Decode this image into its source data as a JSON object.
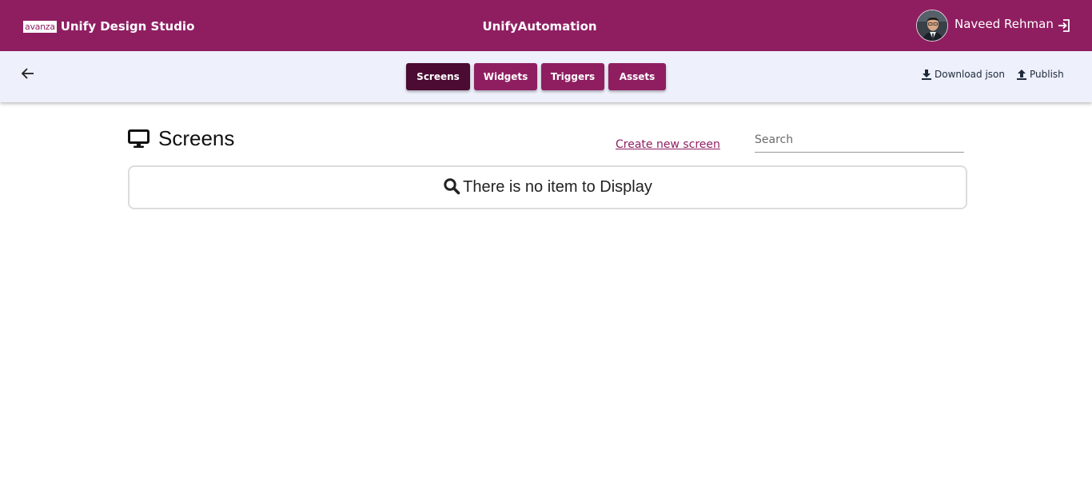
{
  "header": {
    "logo_text": "avanza",
    "app_name": "Unify Design Studio",
    "project_title": "UnifyAutomation",
    "user_name": "Naveed Rehman"
  },
  "toolbar": {
    "tabs": [
      {
        "label": "Screens",
        "active": true
      },
      {
        "label": "Widgets",
        "active": false
      },
      {
        "label": "Triggers",
        "active": false
      },
      {
        "label": "Assets",
        "active": false
      }
    ],
    "download_label": "Download json",
    "publish_label": "Publish"
  },
  "main": {
    "title": "Screens",
    "create_link": "Create new screen",
    "search_placeholder": "Search",
    "empty_message": "There is no item to Display"
  },
  "colors": {
    "brand": "#8f1e61",
    "tab_active": "#4b0b33",
    "subbar_bg": "#eef0fb"
  }
}
